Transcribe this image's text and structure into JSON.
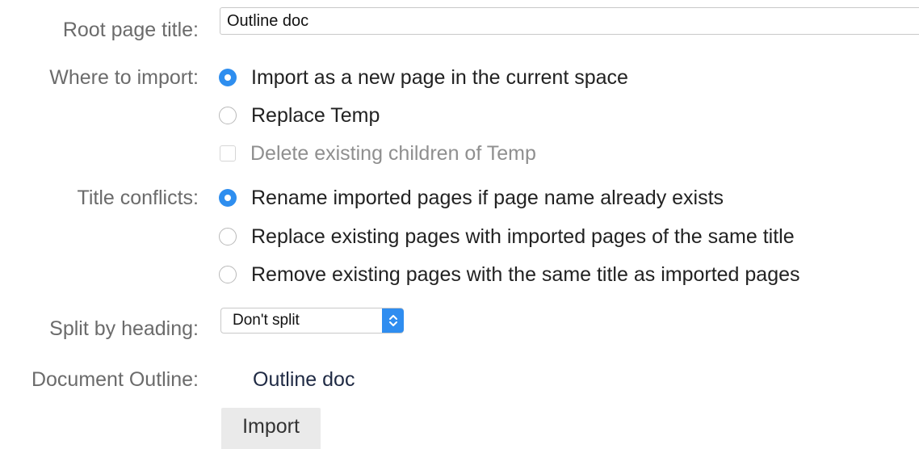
{
  "fields": {
    "root_page_title": {
      "label": "Root page title:",
      "value": "Outline doc"
    },
    "where_to_import": {
      "label": "Where to import:",
      "options": [
        {
          "label": "Import as a new page in the current space",
          "selected": true
        },
        {
          "label": "Replace Temp",
          "selected": false
        }
      ],
      "sub_option": {
        "label": "Delete existing children of Temp",
        "checked": false,
        "disabled": true
      }
    },
    "title_conflicts": {
      "label": "Title conflicts:",
      "options": [
        {
          "label": "Rename imported pages if page name already exists",
          "selected": true
        },
        {
          "label": "Replace existing pages with imported pages of the same title",
          "selected": false
        },
        {
          "label": "Remove existing pages with the same title as imported pages",
          "selected": false
        }
      ]
    },
    "split_by_heading": {
      "label": "Split by heading:",
      "selected": "Don't split",
      "icon": "updown-chevron-icon"
    },
    "document_outline": {
      "label": "Document Outline:",
      "value": "Outline doc"
    }
  },
  "actions": {
    "import_label": "Import"
  },
  "colors": {
    "accent": "#2e8eef",
    "label_text": "#6b6b6b",
    "button_bg": "#eaeaea"
  }
}
